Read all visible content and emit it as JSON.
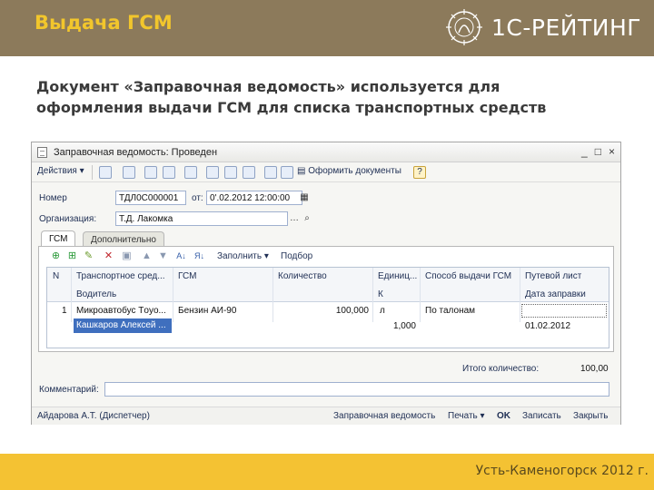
{
  "slide": {
    "title": "Выдача ГСМ",
    "brand": "1С-РЕЙТИНГ",
    "text_line1": "Документ «Заправочная ведомость» используется для",
    "text_line2": "оформления выдачи ГСМ для списка транспортных средств",
    "footer": "Усть-Каменогорск  2012 г.",
    "colors": {
      "header": "#8c7a5b",
      "title": "#f2c62c",
      "footer": "#f4c233"
    }
  },
  "window": {
    "title": "Заправочная ведомость: Проведен",
    "controls": [
      "_",
      "□",
      "×"
    ],
    "toolbar": {
      "actions": "Действия",
      "format": "Оформить документы",
      "help": "?"
    },
    "number_label": "Номер",
    "number_value": "ТДЛ0С000001",
    "date_label": "от:",
    "date_value": "0'.02.2012 12:00:00",
    "org_label": "Организация:",
    "org_value": "Т.Д. Лакомка",
    "tabs": {
      "gsm": "ГСМ",
      "extra": "Дополнительно"
    },
    "table_toolbar": {
      "fill": "Заполнить",
      "select": "Подбор"
    },
    "columns": {
      "n": "N",
      "vehicle": "Транспортное сред...",
      "driver": "Водитель",
      "gsm": "ГСМ",
      "qty": "Количество",
      "unit": "Единиц...",
      "unit2": "К",
      "method": "Способ выдачи ГСМ",
      "waybill": "Путевой лист",
      "refuel_date": "Дата заправки"
    },
    "row": {
      "n": "1",
      "vehicle": "Микроавтобус Тoyo...",
      "driver": "Кашкаров Алексей ...",
      "gsm": "Бензин АИ-90",
      "qty": "100,000",
      "unit": "л",
      "coef": "1,000",
      "method": "По талонам",
      "refuel_date": "01.02.2012"
    },
    "total_label": "Итого количество:",
    "total_value": "100,00",
    "comment_label": "Комментарий:",
    "bottom": {
      "user": "Айдарова А.Т. (Диспетчер)",
      "print_form": "Заправочная ведомость",
      "print": "Печать",
      "ok": "OK",
      "save": "Записать",
      "close": "Закрыть"
    }
  }
}
